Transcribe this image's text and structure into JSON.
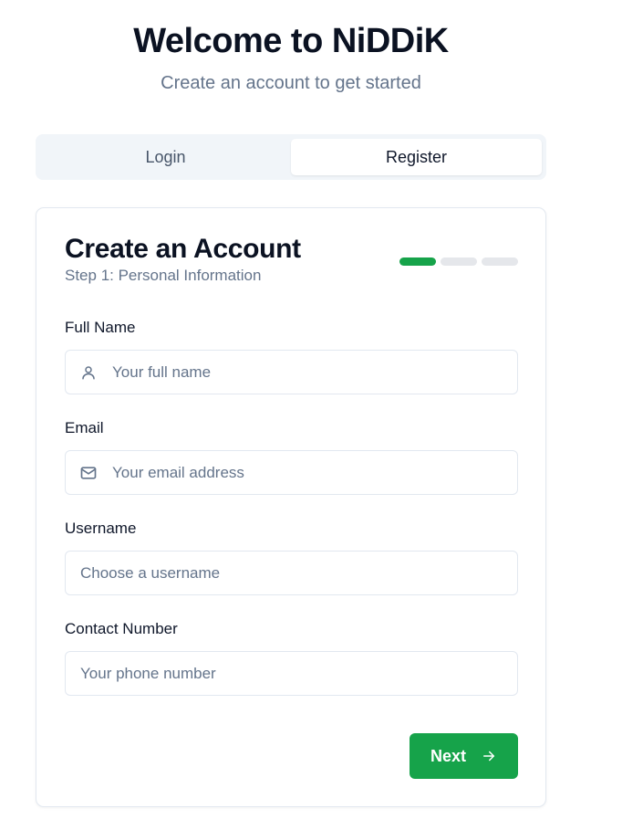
{
  "header": {
    "title": "Welcome to NiDDiK",
    "subtitle": "Create an account to get started"
  },
  "tabs": [
    {
      "label": "Login",
      "active": false
    },
    {
      "label": "Register",
      "active": true
    }
  ],
  "card": {
    "title": "Create an Account",
    "step": "Step 1: Personal Information",
    "progress": {
      "current_step": 1,
      "total_steps": 3
    }
  },
  "form": {
    "full_name": {
      "label": "Full Name",
      "placeholder": "Your full name",
      "value": "",
      "icon": "user-icon"
    },
    "email": {
      "label": "Email",
      "placeholder": "Your email address",
      "value": "",
      "icon": "mail-icon"
    },
    "username": {
      "label": "Username",
      "placeholder": "Choose a username",
      "value": ""
    },
    "contact": {
      "label": "Contact Number",
      "placeholder": "Your phone number",
      "value": ""
    }
  },
  "actions": {
    "next_label": "Next",
    "next_icon": "arrow-right-icon"
  },
  "colors": {
    "accent": "#16a34a",
    "inactive_progress": "#e5e7eb",
    "tabs_background": "#f1f5f9",
    "muted_text": "#64748b"
  }
}
